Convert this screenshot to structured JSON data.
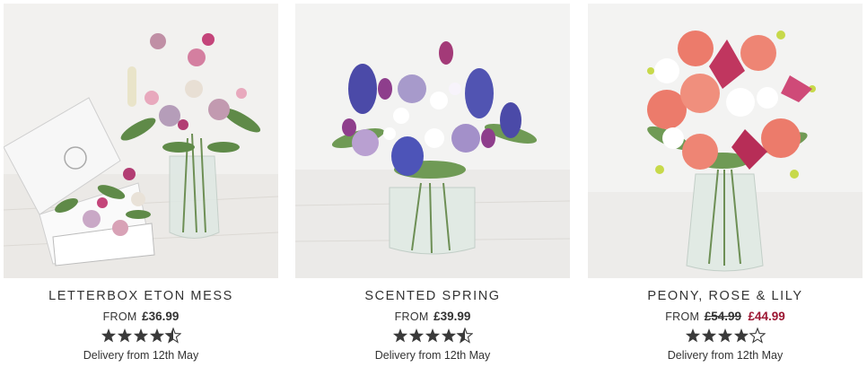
{
  "products": [
    {
      "name": "LETTERBOX ETON MESS",
      "from_label": "FROM",
      "price": "£36.99",
      "rating": 4.5,
      "delivery": "Delivery from 12th May",
      "image_icon": "letterbox-bouquet-image"
    },
    {
      "name": "SCENTED SPRING",
      "from_label": "FROM",
      "price": "£39.99",
      "rating": 4.5,
      "delivery": "Delivery from 12th May",
      "image_icon": "spring-bouquet-image"
    },
    {
      "name": "PEONY, ROSE & LILY",
      "from_label": "FROM",
      "price_was": "£54.99",
      "price_now": "£44.99",
      "rating": 4,
      "delivery": "Delivery from 12th May",
      "image_icon": "peony-bouquet-image"
    }
  ],
  "colors": {
    "text": "#333333",
    "sale": "#9c1632",
    "star": "#3a3a3a"
  }
}
